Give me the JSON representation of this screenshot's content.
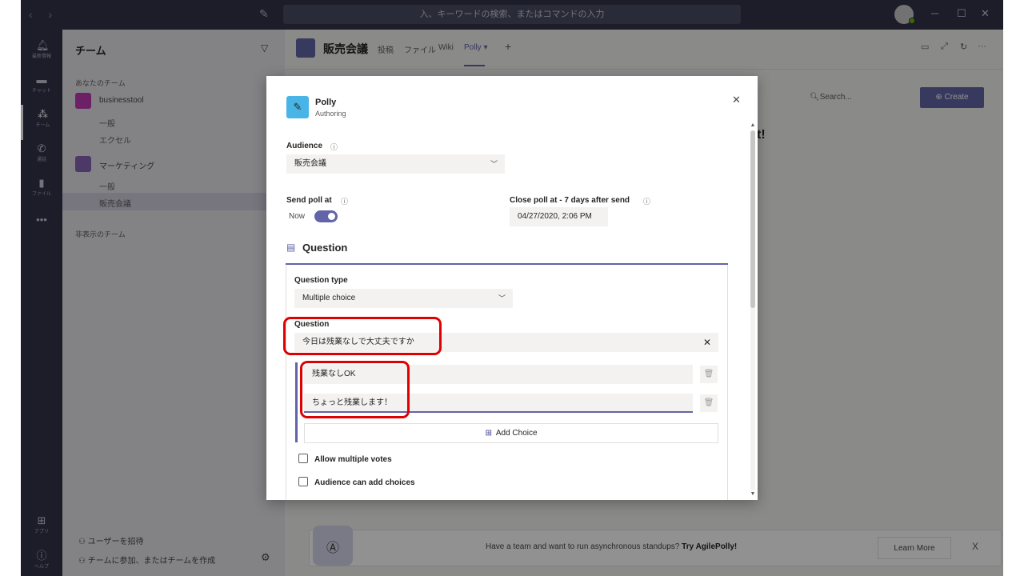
{
  "titlebar": {
    "search_placeholder": "入、キーワードの検索、またはコマンドの入力",
    "nav_arrows": "‹ ›",
    "minimize": "─",
    "maximize": "☐",
    "close": "✕"
  },
  "rail": {
    "items": [
      {
        "label": "最新情報",
        "icon": "bell-icon"
      },
      {
        "label": "チャット",
        "icon": "chat-icon"
      },
      {
        "label": "チーム",
        "icon": "teams-icon"
      },
      {
        "label": "通話",
        "icon": "phone-icon"
      },
      {
        "label": "ファイル",
        "icon": "file-icon"
      }
    ],
    "more": "•••",
    "bottom": [
      {
        "label": "アプリ",
        "icon": "apps-icon"
      },
      {
        "label": "ヘルプ",
        "icon": "help-icon"
      }
    ]
  },
  "leftpanel": {
    "title": "チーム",
    "section_yours": "あなたのチーム",
    "teams": [
      {
        "name": "businesstool",
        "color": "#c239b3",
        "channels": [
          "一般",
          "エクセル"
        ]
      },
      {
        "name": "マーケティング",
        "color": "#8764b8",
        "channels": [
          "一般",
          "販売会議"
        ]
      }
    ],
    "section_hidden": "非表示のチーム",
    "invite": "ユーザーを招待",
    "join_create": "チームに参加、またはチームを作成"
  },
  "mainhead": {
    "title": "販売会議",
    "tabs": [
      "投稿",
      "ファイル",
      "Wiki",
      "Polly ▾"
    ],
    "add_tab": "+"
  },
  "content": {
    "search": "Search...",
    "create": "Create",
    "partial_text": "t!"
  },
  "banner": {
    "text_prefix": "Have a team and want to run asynchronous standups?",
    "text_link": "Try AgilePolly!",
    "learn_more": "Learn More",
    "close": "X"
  },
  "dialog": {
    "app_name": "Polly",
    "app_sub": "Authoring",
    "audience_label": "Audience",
    "audience_value": "販売会議",
    "send_label": "Send poll at",
    "send_now": "Now",
    "send_toggle_on": true,
    "close_label": "Close poll at - 7 days after send",
    "close_value": "04/27/2020, 2:06 PM",
    "question_heading": "Question",
    "question_type_label": "Question type",
    "question_type_value": "Multiple choice",
    "question_label": "Question",
    "question_value": "今日は残業なしで大丈夫ですか",
    "choices": [
      "残業なしOK",
      "ちょっと残業します！"
    ],
    "add_choice": "Add Choice",
    "allow_multiple": "Allow multiple votes",
    "audience_add": "Audience can add choices"
  },
  "colors": {
    "accent": "#6264a7",
    "rail_bg": "#33344a",
    "highlight": "#e00000"
  }
}
